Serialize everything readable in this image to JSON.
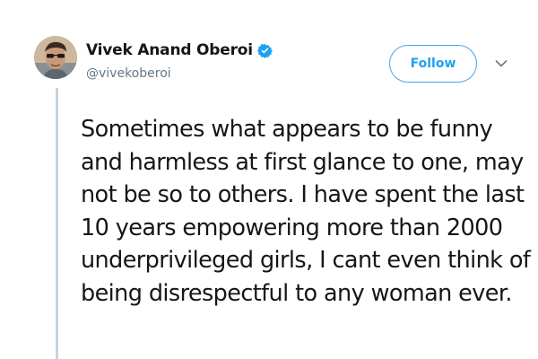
{
  "author": {
    "display_name": "Vivek Anand Oberoi",
    "handle": "@vivekoberoi",
    "verified": true,
    "avatar_icon": "profile-photo"
  },
  "actions": {
    "follow_label": "Follow",
    "menu_icon": "chevron-down-icon"
  },
  "tweet": {
    "lines": [
      "Sometimes what appears to be funny",
      "and harmless at first glance to one, may",
      "not be so to others. I have spent the last",
      "10 years empowering more than 2000",
      "underprivileged girls, I cant even think of",
      "being disrespectful to any woman ever."
    ]
  },
  "colors": {
    "brand_blue": "#1da1f2",
    "follow_border": "#4aa1eb",
    "text_primary": "#14171a",
    "text_secondary": "#657786",
    "thread_line": "#c4d4e0"
  }
}
